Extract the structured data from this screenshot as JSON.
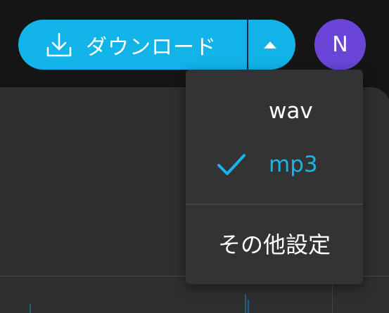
{
  "toolbar": {
    "download_label": "ダウンロード",
    "download_icon": "download-icon",
    "toggle_icon": "caret-up-icon",
    "accent_color": "#11b3e8"
  },
  "user": {
    "avatar_initial": "N",
    "avatar_color": "#6a45d8"
  },
  "format_menu": {
    "items": [
      {
        "label": "wav",
        "selected": false
      },
      {
        "label": "mp3",
        "selected": true
      }
    ],
    "selected_icon": "checkmark-icon",
    "settings_label": "その他設定"
  }
}
